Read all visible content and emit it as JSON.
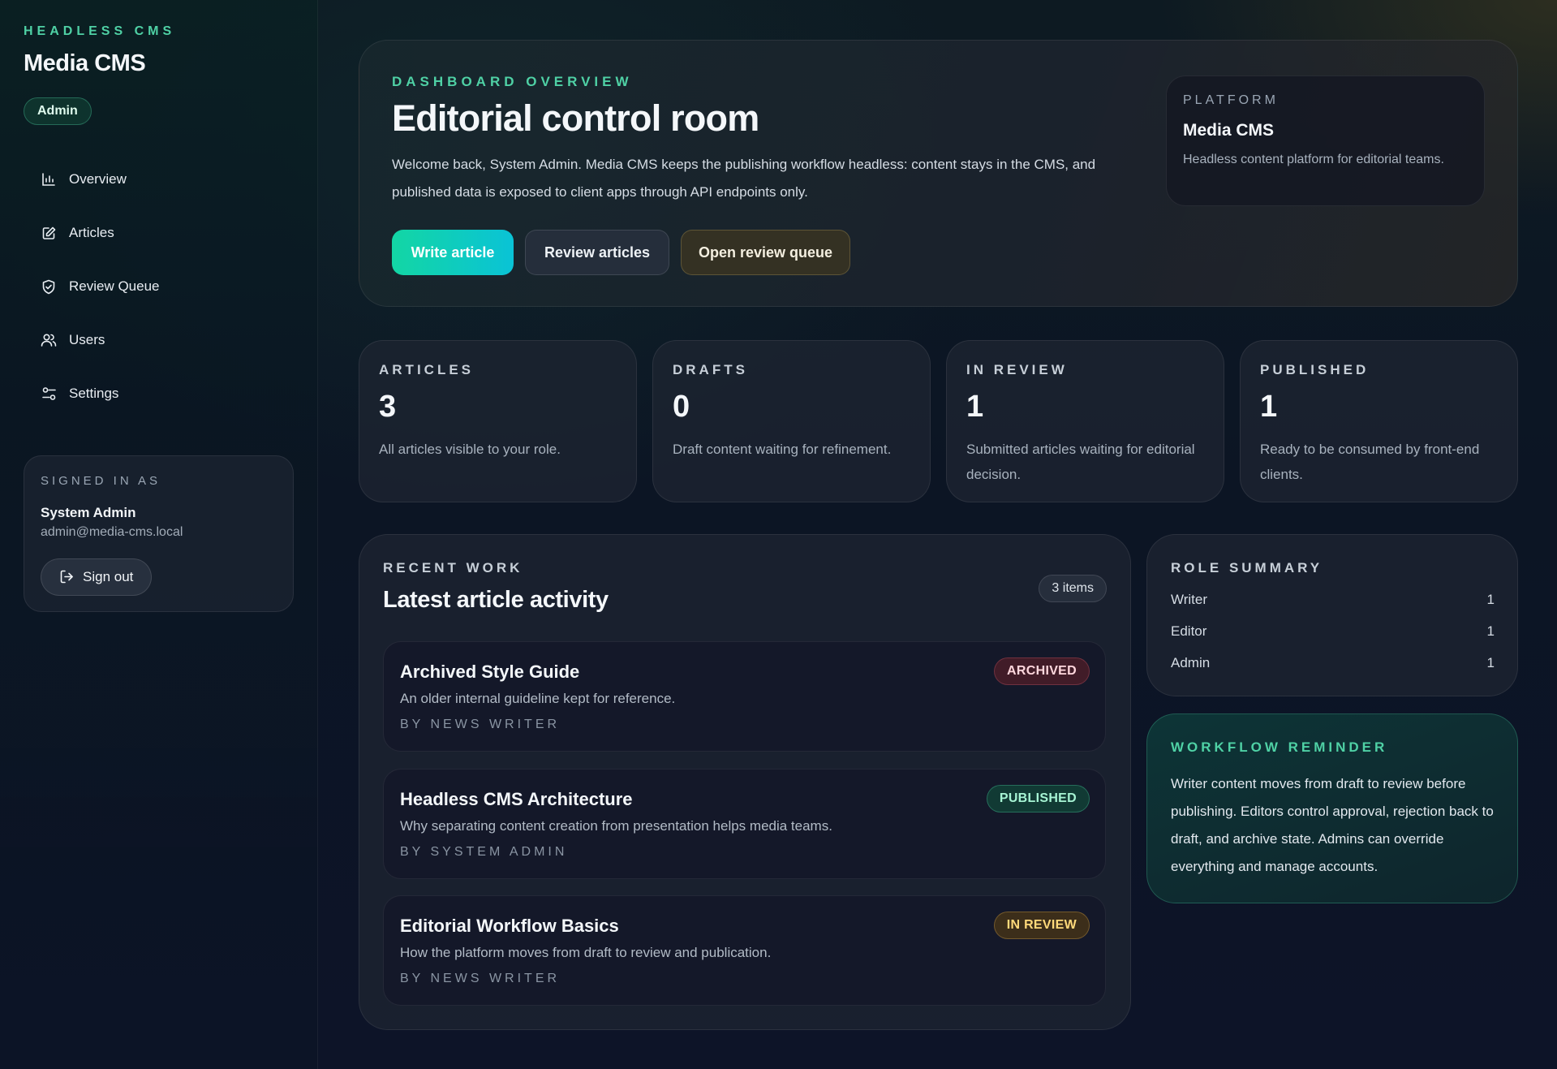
{
  "sidebar": {
    "eyebrow": "HEADLESS CMS",
    "app_title": "Media CMS",
    "role_badge": "Admin",
    "nav": [
      {
        "label": "Overview",
        "icon": "bar-chart-icon"
      },
      {
        "label": "Articles",
        "icon": "edit-icon"
      },
      {
        "label": "Review Queue",
        "icon": "shield-check-icon"
      },
      {
        "label": "Users",
        "icon": "users-icon"
      },
      {
        "label": "Settings",
        "icon": "settings-sliders-icon"
      }
    ],
    "signed_in": {
      "eyebrow": "SIGNED IN AS",
      "name": "System Admin",
      "email": "admin@media-cms.local",
      "signout_label": "Sign out"
    }
  },
  "hero": {
    "eyebrow": "DASHBOARD OVERVIEW",
    "title": "Editorial control room",
    "description": "Welcome back, System Admin. Media CMS keeps the publishing workflow headless: content stays in the CMS, and published data is exposed to client apps through API endpoints only.",
    "buttons": {
      "write": "Write article",
      "review": "Review articles",
      "queue": "Open review queue"
    },
    "platform": {
      "eyebrow": "PLATFORM",
      "name": "Media CMS",
      "description": "Headless content platform for editorial teams."
    }
  },
  "stats": [
    {
      "label": "ARTICLES",
      "value": "3",
      "description": "All articles visible to your role."
    },
    {
      "label": "DRAFTS",
      "value": "0",
      "description": "Draft content waiting for refinement."
    },
    {
      "label": "IN REVIEW",
      "value": "1",
      "description": "Submitted articles waiting for editorial decision."
    },
    {
      "label": "PUBLISHED",
      "value": "1",
      "description": "Ready to be consumed by front-end clients."
    }
  ],
  "recent": {
    "eyebrow": "RECENT WORK",
    "title": "Latest article activity",
    "count": "3 items",
    "articles": [
      {
        "title": "Archived Style Guide",
        "description": "An older internal guideline kept for reference.",
        "author": "BY NEWS WRITER",
        "status": "ARCHIVED"
      },
      {
        "title": "Headless CMS Architecture",
        "description": "Why separating content creation from presentation helps media teams.",
        "author": "BY SYSTEM ADMIN",
        "status": "PUBLISHED"
      },
      {
        "title": "Editorial Workflow Basics",
        "description": "How the platform moves from draft to review and publication.",
        "author": "BY NEWS WRITER",
        "status": "IN REVIEW"
      }
    ]
  },
  "roles": {
    "eyebrow": "ROLE SUMMARY",
    "rows": [
      {
        "role": "Writer",
        "count": "1"
      },
      {
        "role": "Editor",
        "count": "1"
      },
      {
        "role": "Admin",
        "count": "1"
      }
    ]
  },
  "reminder": {
    "eyebrow": "WORKFLOW REMINDER",
    "text": "Writer content moves from draft to review before publishing. Editors control approval, rejection back to draft, and archive state. Admins can override everything and manage accounts."
  },
  "colors": {
    "accent": "#4fd1a5",
    "primary_gradient_start": "#13d6a4",
    "primary_gradient_end": "#0ac3d6",
    "archived": "#ffd7dd",
    "published": "#a6f4d4",
    "in_review": "#ffd97a"
  }
}
